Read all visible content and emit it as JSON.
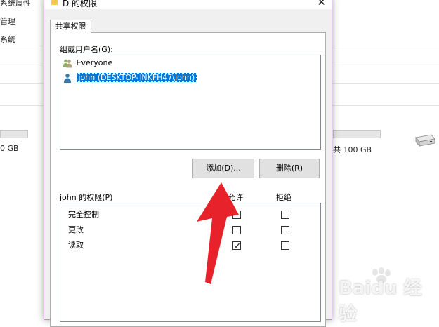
{
  "background": {
    "left_text": [
      "系统属性",
      "管理",
      "系统"
    ],
    "left_capacity": "0 GB",
    "right_capacity": "共 100 GB"
  },
  "dialog": {
    "title": "D 的权限",
    "close_glyph": "✕",
    "tab_label": "共享权限",
    "group_label": "组或用户名(G):",
    "users": [
      {
        "name": "Everyone",
        "selected": false
      },
      {
        "name": "john (DESKTOP-JNKFH47\\john)",
        "selected": true
      }
    ],
    "add_button": "添加(D)...",
    "remove_button": "删除(R)",
    "perm_label": "john 的权限(P)",
    "allow_header": "允许",
    "deny_header": "拒绝",
    "permissions": [
      {
        "name": "完全控制",
        "allow": false,
        "deny": false
      },
      {
        "name": "更改",
        "allow": false,
        "deny": false
      },
      {
        "name": "读取",
        "allow": true,
        "deny": false
      }
    ]
  },
  "annotation": {
    "arrow_color": "#e8222b"
  },
  "watermark": {
    "text": "Baidu 经验"
  }
}
